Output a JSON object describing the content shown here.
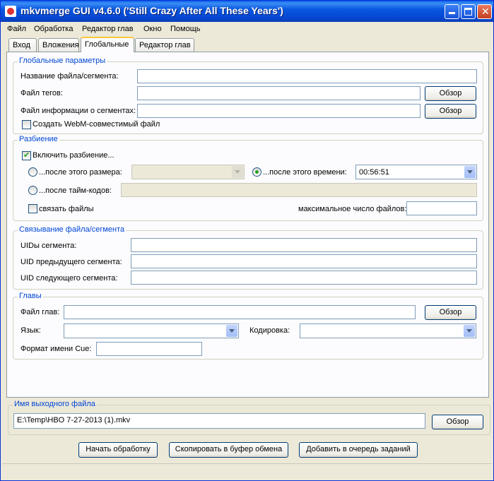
{
  "window": {
    "title": "mkvmerge GUI v4.6.0 ('Still Crazy After All These Years')"
  },
  "menu": [
    "Файл",
    "Обработка",
    "Редактор глав",
    "Окно",
    "Помощь"
  ],
  "tabs": [
    "Вход",
    "Вложения",
    "Глобальные",
    "Редактор глав"
  ],
  "active_tab": "Глобальные",
  "global": {
    "title": "Глобальные параметры",
    "segment_title_label": "Название файла/сегмента:",
    "segment_title_value": "",
    "tags_label": "Файл тегов:",
    "tags_value": "",
    "segment_info_label": "Файл информации о сегментах:",
    "segment_info_value": "",
    "webm_label": "Создать WebM-совместимый файл",
    "browse": "Обзор"
  },
  "split": {
    "title": "Разбиение",
    "enable_label": "Включить разбиение...",
    "after_size_label": "...после этого размера:",
    "after_time_label": "...после этого времени:",
    "after_time_value": "00:56:51",
    "after_timecodes_label": "...после тайм-кодов:",
    "link_label": "связать файлы",
    "max_files_label": "максимальное число файлов:",
    "max_files_value": ""
  },
  "linking": {
    "title": "Связывание файла/сегмента",
    "uids_label": "UIDы сегмента:",
    "prev_uid_label": "UID предыдущего сегмента:",
    "next_uid_label": "UID следующего сегмента:"
  },
  "chapters": {
    "title": "Главы",
    "file_label": "Файл глав:",
    "language_label": "Язык:",
    "charset_label": "Кодировка:",
    "cue_label": "Формат имени Cue:",
    "browse": "Обзор"
  },
  "output": {
    "title": "Имя выходного файла",
    "value": "E:\\Temp\\HBO 7-27-2013 (1).mkv",
    "browse": "Обзор"
  },
  "actions": {
    "start": "Начать обработку",
    "copy": "Скопировать в буфер обмена",
    "queue": "Добавить в очередь заданий"
  }
}
